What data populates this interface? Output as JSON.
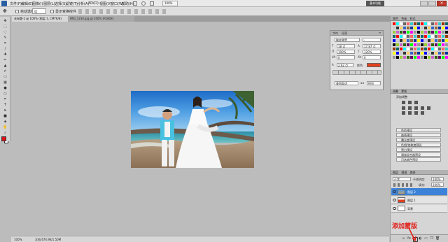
{
  "menu": [
    "文件(F)",
    "编辑(E)",
    "图像(I)",
    "图层(L)",
    "选择(S)",
    "滤镜(T)",
    "分析(A)",
    "3D(D)",
    "视图(V)",
    "窗口(W)",
    "帮助(H)"
  ],
  "workspace_button": "基本功能",
  "zoom_menubar": "100%",
  "options": {
    "auto_select_label": "自动选择:",
    "auto_select_value": "组",
    "show_transform": "显示变换控件"
  },
  "tabs": [
    {
      "label": "未标题-1 @ 100% (图层 1, CMYK/8)"
    },
    {
      "label": "IMG_1234.jpg @ 100% (RGB/8)"
    }
  ],
  "status": {
    "zoom": "100%",
    "doc": "文档:674.9K/1.50M"
  },
  "char_panel": {
    "tab1": "字符",
    "tab2": "段落",
    "font_family": "微软雅黑",
    "font_style": "-",
    "size": "18 点",
    "leading": "17.87 点",
    "v_scale": "100%",
    "h_scale": "120%",
    "tracking": "0",
    "kerning": "0",
    "baseline": "2.62 点",
    "color_label": "颜色:",
    "lang": "美国英语",
    "aa": "锐利",
    "text_color": "#e3431e"
  },
  "colors_panel": {
    "tab1": "颜色",
    "tab2": "色板",
    "tab3": "样式"
  },
  "adjust_panel": {
    "tab1": "调整",
    "tab2": "蒙版",
    "title": "添加调整",
    "presets": [
      "色阶预设",
      "曲线预设",
      "曝光度预设",
      "色相/饱和度预设",
      "黑白预设",
      "通道混合器预设",
      "可选颜色预设"
    ]
  },
  "layers_panel": {
    "tab1": "图层",
    "tab2": "通道",
    "tab3": "路径",
    "blend_mode": "正常",
    "opacity_label": "不透明度:",
    "opacity": "100%",
    "fill_label": "填充:",
    "fill": "100%",
    "layers": [
      {
        "name": "图层 2",
        "selected": true
      },
      {
        "name": "图层 1",
        "selected": false
      },
      {
        "name": "背景",
        "selected": false
      }
    ]
  },
  "annotation": "添加蒙版",
  "colors": {
    "accent": "#3c82d8",
    "annotation": "#e0201a",
    "foreground": "#e0101a"
  }
}
